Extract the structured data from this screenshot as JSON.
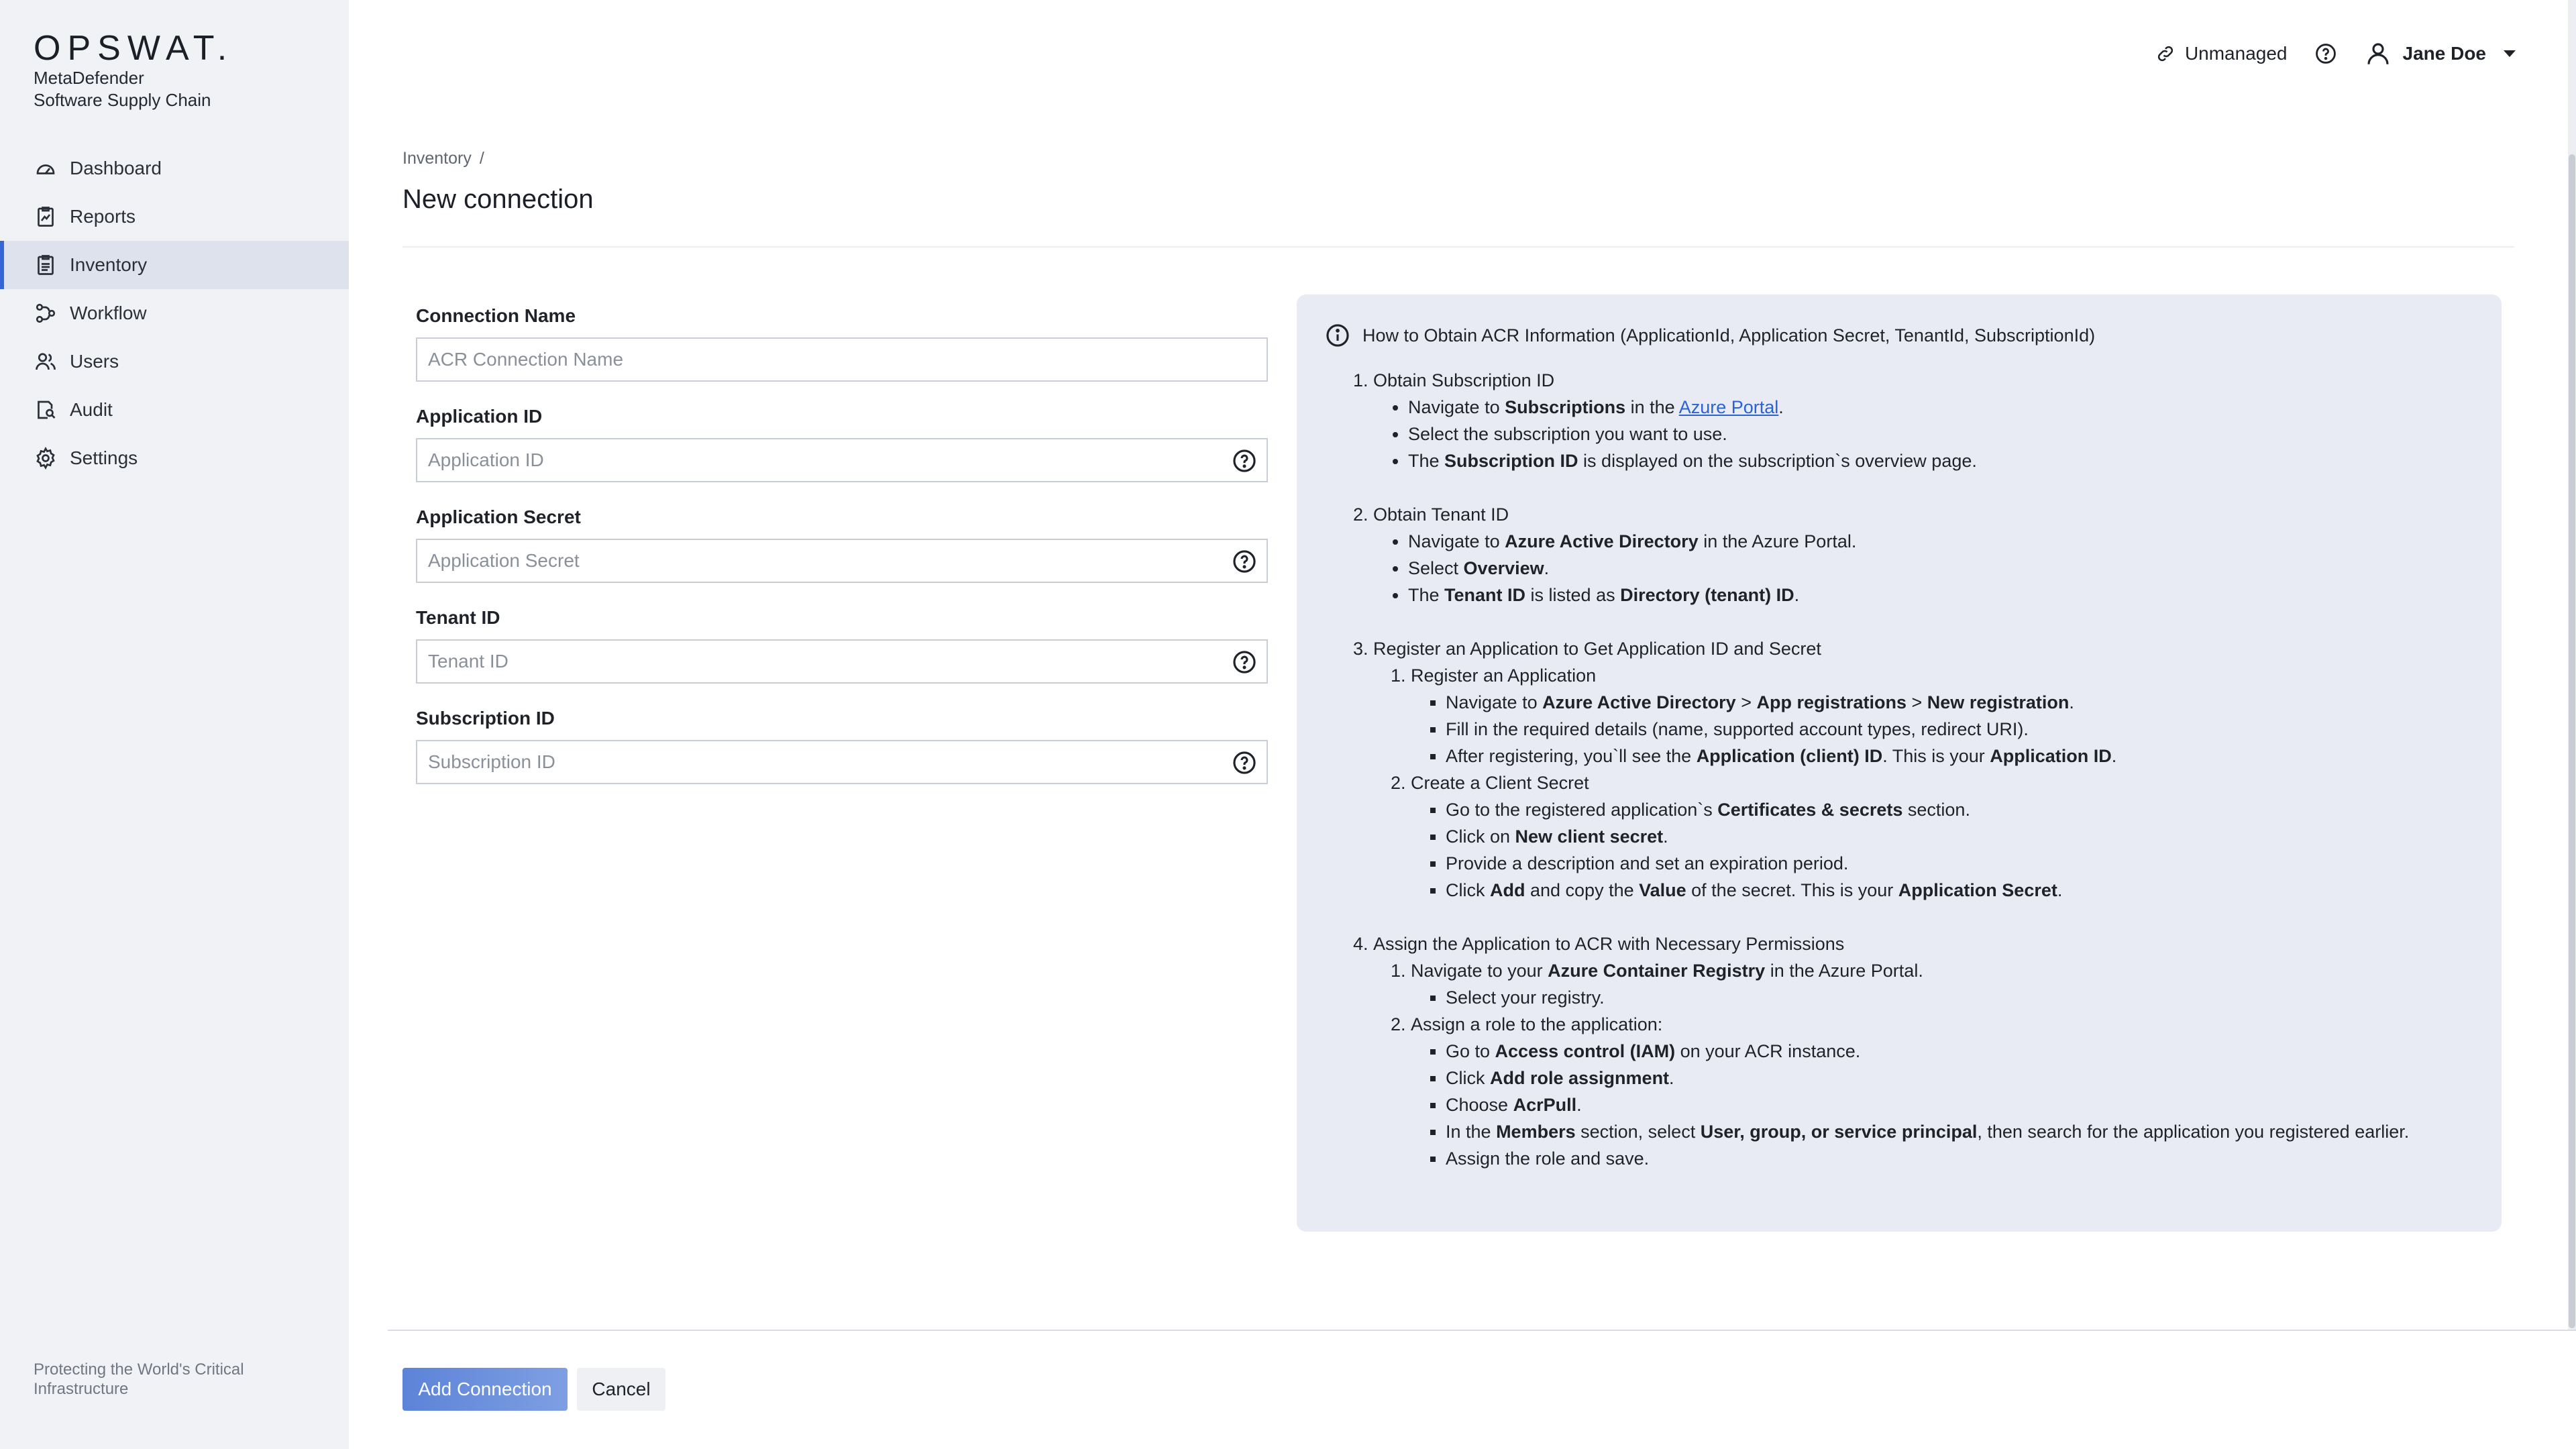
{
  "brand": {
    "logo": "OPSWAT.",
    "product_line1": "MetaDefender",
    "product_line2": "Software Supply Chain",
    "tagline": "Protecting the World's Critical Infrastructure"
  },
  "nav": {
    "items": [
      {
        "label": "Dashboard",
        "icon": "dashboard-icon",
        "active": false
      },
      {
        "label": "Reports",
        "icon": "reports-icon",
        "active": false
      },
      {
        "label": "Inventory",
        "icon": "inventory-icon",
        "active": true
      },
      {
        "label": "Workflow",
        "icon": "workflow-icon",
        "active": false
      },
      {
        "label": "Users",
        "icon": "users-icon",
        "active": false
      },
      {
        "label": "Audit",
        "icon": "audit-icon",
        "active": false
      },
      {
        "label": "Settings",
        "icon": "settings-icon",
        "active": false
      }
    ]
  },
  "topbar": {
    "status": "Unmanaged",
    "user_name": "Jane Doe"
  },
  "header": {
    "breadcrumb": "Inventory",
    "breadcrumb_sep": "/",
    "title": "New connection"
  },
  "form": {
    "fields": [
      {
        "label": "Connection Name",
        "placeholder": "ACR Connection Name",
        "value": ""
      },
      {
        "label": "Application ID",
        "placeholder": "Application ID",
        "value": ""
      },
      {
        "label": "Application Secret",
        "placeholder": "Application Secret",
        "value": ""
      },
      {
        "label": "Tenant ID",
        "placeholder": "Tenant ID",
        "value": ""
      },
      {
        "label": "Subscription ID",
        "placeholder": "Subscription ID",
        "value": ""
      }
    ]
  },
  "info": {
    "title": "How to Obtain ACR Information (ApplicationId, Application Secret, TenantId, SubscriptionId)",
    "link_text": "Azure Portal",
    "s1": {
      "heading": "Obtain Subscription ID",
      "b1": [
        "Navigate to ",
        "Subscriptions",
        " in the ",
        "."
      ],
      "b2": "Select the subscription you want to use.",
      "b3": [
        "The ",
        "Subscription ID",
        " is displayed on the subscription`s overview page."
      ]
    },
    "s2": {
      "heading": "Obtain Tenant ID",
      "b1": [
        "Navigate to ",
        "Azure Active Directory",
        " in the Azure Portal."
      ],
      "b2": [
        "Select ",
        "Overview",
        "."
      ],
      "b3": [
        "The ",
        "Tenant ID",
        " is listed as ",
        "Directory (tenant) ID",
        "."
      ]
    },
    "s3": {
      "heading": "Register an Application to Get Application ID and Secret",
      "sub1": "Register an Application",
      "sub1_b1": [
        "Navigate to ",
        "Azure Active Directory",
        " > ",
        "App registrations",
        " > ",
        "New registration",
        "."
      ],
      "sub1_b2": "Fill in the required details (name, supported account types, redirect URI).",
      "sub1_b3": [
        "After registering, you`ll see the ",
        "Application (client) ID",
        ". This is your ",
        "Application ID",
        "."
      ],
      "sub2": "Create a Client Secret",
      "sub2_b1": [
        "Go to the registered application`s ",
        "Certificates & secrets",
        " section."
      ],
      "sub2_b2": [
        "Click on ",
        "New client secret",
        "."
      ],
      "sub2_b3": "Provide a description and set an expiration period.",
      "sub2_b4": [
        "Click ",
        "Add",
        " and copy the ",
        "Value",
        " of the secret. This is your ",
        "Application Secret",
        "."
      ]
    },
    "s4": {
      "heading": "Assign the Application to ACR with Necessary Permissions",
      "sub1": [
        "Navigate to your ",
        "Azure Container Registry",
        " in the Azure Portal."
      ],
      "sub1_b1": "Select your registry.",
      "sub2": "Assign a role to the application:",
      "sub2_b1": [
        "Go to ",
        "Access control (IAM)",
        " on your ACR instance."
      ],
      "sub2_b2": [
        "Click ",
        "Add role assignment",
        "."
      ],
      "sub2_b3": [
        "Choose ",
        "AcrPull",
        "."
      ],
      "sub2_b4": [
        "In the ",
        "Members",
        " section, select ",
        "User, group, or service principal",
        ", then search for the application you registered earlier."
      ],
      "sub2_b5": "Assign the role and save."
    }
  },
  "footer": {
    "primary_label": "Add Connection",
    "secondary_label": "Cancel"
  },
  "colors": {
    "accent": "#3466d6",
    "sidebar_bg": "#f1f2f5",
    "panel_bg": "#e8ebf3",
    "link": "#2a63d4"
  }
}
